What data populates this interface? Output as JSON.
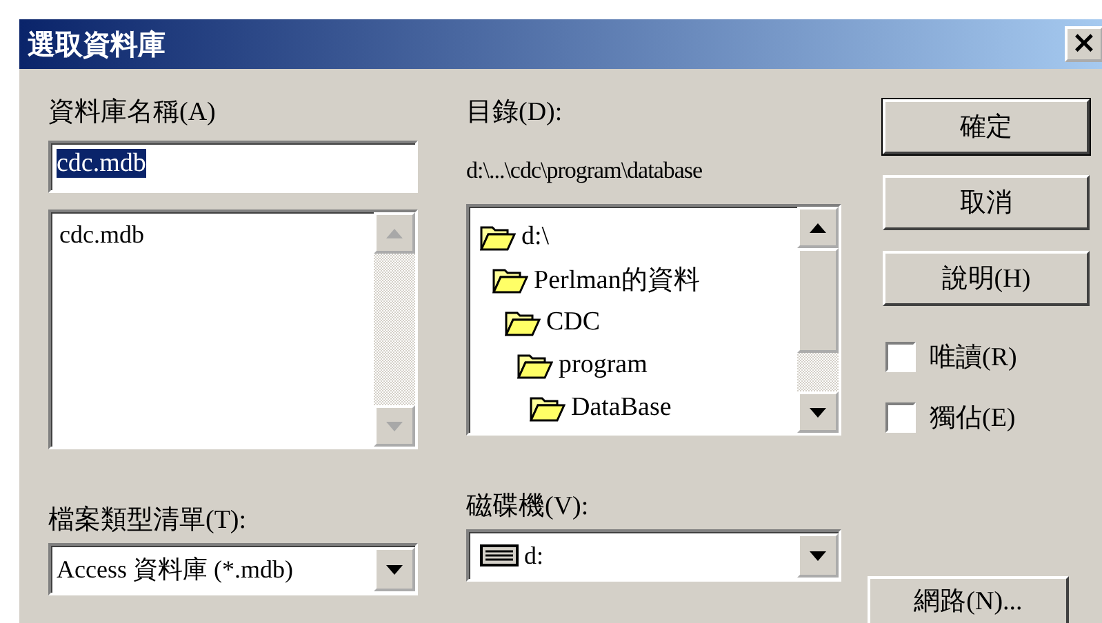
{
  "window": {
    "title": "選取資料庫",
    "close": "×"
  },
  "database_name": {
    "label": "資料庫名稱(A)",
    "value": "cdc.mdb",
    "files": [
      "cdc.mdb"
    ]
  },
  "directory": {
    "label": "目錄(D):",
    "path": "d:\\...\\cdc\\program\\database",
    "tree": [
      {
        "name": "d:\\",
        "children": [
          {
            "name": "Perlman的資料",
            "children": [
              {
                "name": "CDC",
                "children": [
                  {
                    "name": "program",
                    "children": [
                      {
                        "name": "DataBase"
                      }
                    ]
                  }
                ]
              }
            ]
          }
        ]
      }
    ]
  },
  "buttons": [
    "確定",
    "取消",
    "說明(H)"
  ],
  "options": [
    {
      "label": "唯讀(R)",
      "checked": false
    },
    {
      "label": "獨佔(E)",
      "checked": false
    }
  ],
  "file_types": {
    "label": "檔案類型清單(T):",
    "value": "Access 資料庫 (*.mdb)"
  },
  "drives": {
    "label": "磁碟機(V):",
    "value": "d:"
  },
  "network_button": "網路(N)..."
}
